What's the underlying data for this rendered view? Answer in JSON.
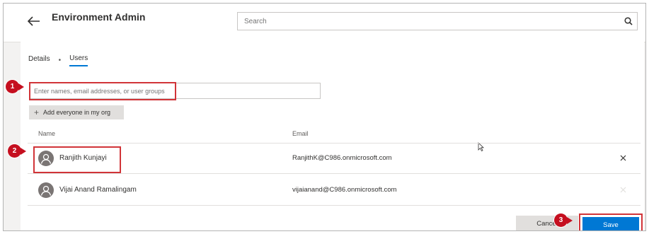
{
  "header": {
    "title": "Environment Admin",
    "search_placeholder": "Search"
  },
  "tabs": [
    {
      "label": "Details",
      "active": false
    },
    {
      "label": "Users",
      "active": true
    }
  ],
  "add_people": {
    "placeholder": "Enter names, email addresses, or user groups",
    "add_everyone_label": "Add everyone in my org"
  },
  "table": {
    "columns": [
      "Name",
      "Email"
    ],
    "rows": [
      {
        "name": "Ranjith Kunjayi",
        "email": "RanjithK@C986.onmicrosoft.com"
      },
      {
        "name": "Vijai Anand Ramalingam",
        "email": "vijaianand@C986.onmicrosoft.com"
      }
    ]
  },
  "footer": {
    "cancel_label": "Cancel",
    "save_label": "Save"
  },
  "callouts": [
    "1",
    "2",
    "3"
  ],
  "colors": {
    "accent": "#0078d4",
    "callout": "#c50f1f",
    "highlight": "#d13438"
  },
  "icons": [
    "back-arrow-icon",
    "search-icon",
    "plus-icon",
    "person-icon",
    "close-icon",
    "mouse-cursor-icon"
  ]
}
